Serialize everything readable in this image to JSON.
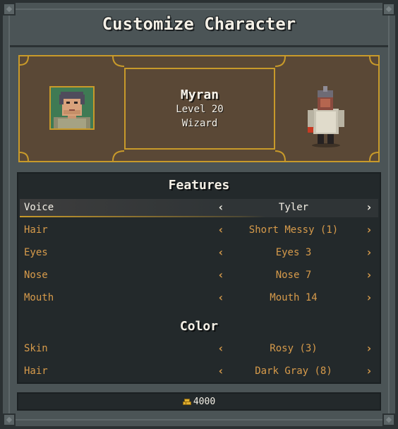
{
  "window": {
    "title": "Customize Character"
  },
  "character": {
    "name": "Myran",
    "level": "Level 20",
    "class": "Wizard",
    "portrait_icon": "character-portrait",
    "sprite_icon": "character-sprite"
  },
  "features": {
    "heading": "Features",
    "rows": [
      {
        "label": "Voice",
        "value": "Tyler",
        "selected": true
      },
      {
        "label": "Hair",
        "value": "Short Messy (1)",
        "selected": false
      },
      {
        "label": "Eyes",
        "value": "Eyes 3",
        "selected": false
      },
      {
        "label": "Nose",
        "value": "Nose 7",
        "selected": false
      },
      {
        "label": "Mouth",
        "value": "Mouth 14",
        "selected": false
      }
    ]
  },
  "color": {
    "heading": "Color",
    "rows": [
      {
        "label": "Skin",
        "value": "Rosy (3)"
      },
      {
        "label": "Hair",
        "value": "Dark Gray (8)"
      }
    ]
  },
  "arrows": {
    "left": "‹",
    "right": "›"
  },
  "gold": {
    "amount": "4000",
    "icon": "gold-coins-icon"
  },
  "colors": {
    "accent_gold": "#c89a2a",
    "label_orange": "#d79b4b",
    "panel_dark": "#23292b",
    "frame_gray": "#4b5456"
  }
}
